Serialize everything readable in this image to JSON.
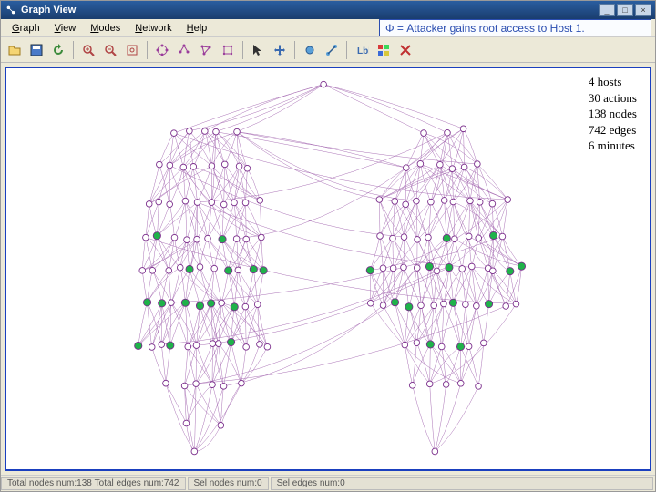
{
  "window": {
    "title": "Graph View"
  },
  "menu": {
    "graph": "Graph",
    "view": "View",
    "modes": "Modes",
    "network": "Network",
    "help": "Help"
  },
  "annotation": {
    "text": "Φ = Attacker gains root access to Host 1."
  },
  "toolbar": {
    "icons": [
      "open-icon",
      "save-icon",
      "refresh-icon",
      "sep",
      "zoom-in-icon",
      "zoom-out-icon",
      "zoom-fit-icon",
      "sep",
      "layout-circular-icon",
      "layout-tree-icon",
      "layout-spring-icon",
      "layout-grid-icon",
      "sep",
      "select-icon",
      "pan-icon",
      "sep",
      "node-icon",
      "edge-icon",
      "sep",
      "label-icon",
      "color-icon",
      "close-icon"
    ]
  },
  "stats": {
    "hosts": "4 hosts",
    "actions": "30 actions",
    "nodes": "138 nodes",
    "edges": "742 edges",
    "time": "6 minutes"
  },
  "status": {
    "total_nodes_label": "Total nodes num:",
    "total_nodes": "138",
    "total_edges_label": "Total edges num:",
    "total_edges": "742",
    "sel_nodes_label": "Sel nodes num:",
    "sel_nodes": "0",
    "sel_edges_label": "Sel edges num:",
    "sel_edges": "0"
  },
  "graph": {
    "edge_color": "#8a3d9b",
    "node_stroke": "#7a2d8b",
    "node_fill_empty": "#ffffff",
    "node_fill_green": "#1fb24a"
  }
}
